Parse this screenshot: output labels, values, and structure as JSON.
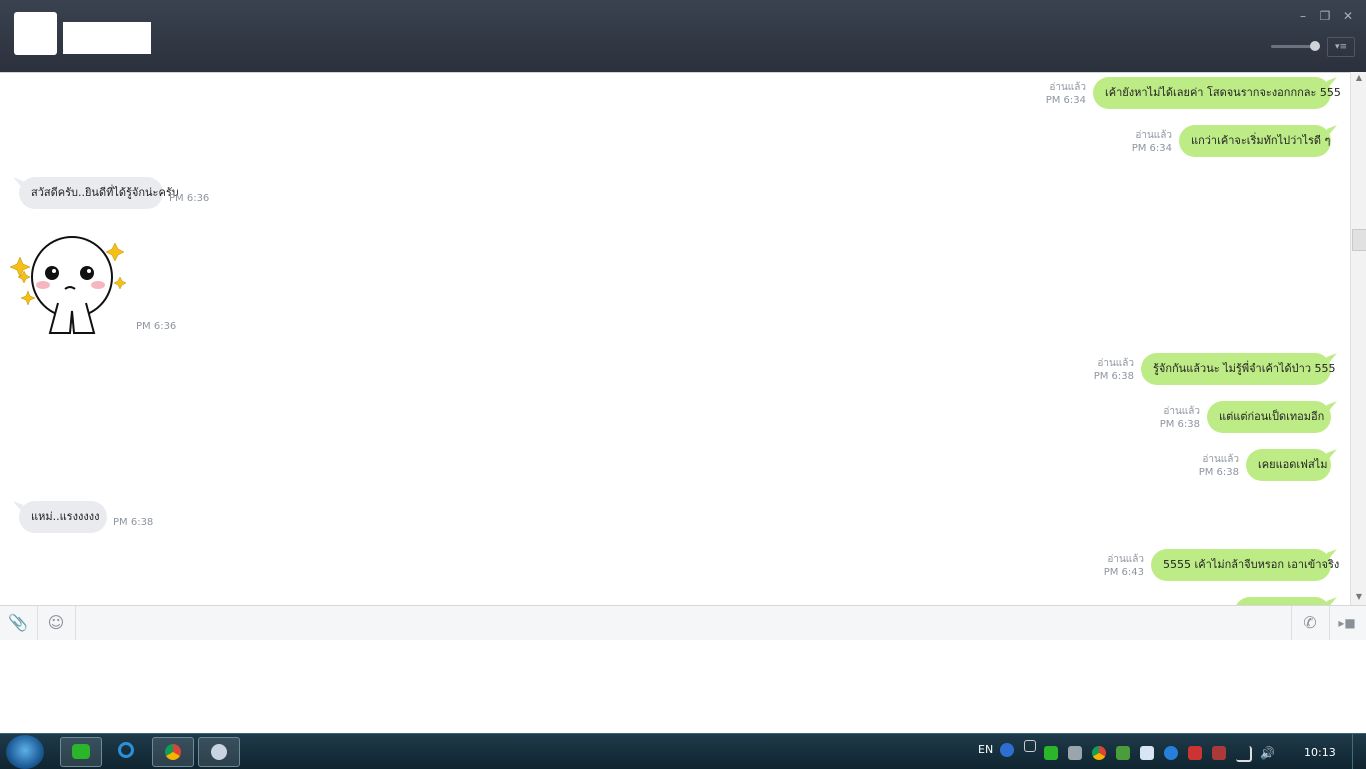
{
  "window": {
    "minimize_icon": "minimize-icon",
    "restore_icon": "restore-icon",
    "close_icon": "close-icon",
    "menu_icon": "menu-icon"
  },
  "messages": [
    {
      "side": "me",
      "text": "เค้ายังหาไม่ได้เลยค่า โสดจนรากจะงอกกกละ 555",
      "read": "อ่านแล้ว",
      "time": "PM 6:34"
    },
    {
      "side": "me",
      "text": "แกว่าเค้าจะเริ่มทักไปว่าไรดี ๆ",
      "read": "อ่านแล้ว",
      "time": "PM 6:34"
    },
    {
      "side": "them",
      "text": "สวัสดีครับ..ยินดีที่ได้รู้จักน่ะครับ",
      "time": "PM 6:36"
    },
    {
      "side": "them",
      "sticker": "sticker-moon-shy",
      "time": "PM 6:36"
    },
    {
      "side": "me",
      "text": "รู้จักกันแล้วนะ ไม่รู้พี่จำเค้าได้ป่าว 555",
      "read": "อ่านแล้ว",
      "time": "PM 6:38"
    },
    {
      "side": "me",
      "text": "แต่แต่ก่อนเป็ดเทอมอีก",
      "read": "อ่านแล้ว",
      "time": "PM 6:38"
    },
    {
      "side": "me",
      "text": "เคยแอดเฟสไม",
      "read": "อ่านแล้ว",
      "time": "PM 6:38"
    },
    {
      "side": "them",
      "text": "แหม่..แรงงงงง",
      "time": "PM 6:38"
    },
    {
      "side": "me",
      "text": "5555 เค้าไม่กล้าจีบหรอก เอาเข้าจริง",
      "read": "อ่านแล้ว",
      "time": "PM 6:43"
    }
  ],
  "toolbar": {
    "attach_icon": "paperclip-icon",
    "emoji_icon": "smiley-icon",
    "call_icon": "phone-icon",
    "video_icon": "video-icon"
  },
  "taskbar": {
    "lang": "EN",
    "clock": "10:13",
    "colors": {
      "accent": "#bdeb86",
      "bubble_them": "#e9ebee",
      "header": "#2f3540"
    }
  }
}
